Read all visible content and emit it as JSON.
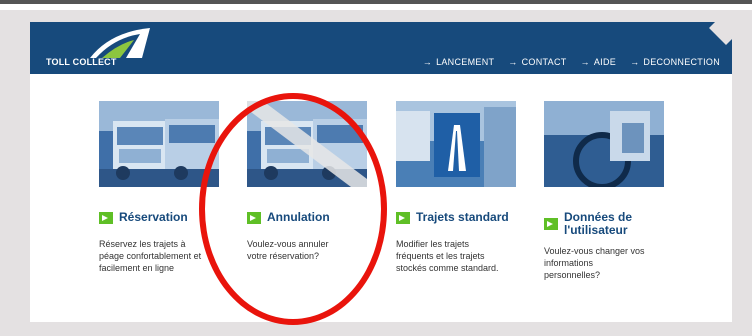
{
  "header": {
    "brand": "TOLL COLLECT",
    "brand_color": "#174a7c",
    "nav": [
      {
        "label": "LANCEMENT"
      },
      {
        "label": "CONTACT"
      },
      {
        "label": "AIDE"
      },
      {
        "label": "DECONNECTION"
      }
    ]
  },
  "cards": [
    {
      "title": "Réservation",
      "desc": [
        "Réservez les trajets à",
        "péage confortablement et",
        "facilement en ligne"
      ],
      "icon": "truck-photo"
    },
    {
      "title": "Annulation",
      "desc": [
        "Voulez-vous annuler",
        "votre réservation?"
      ],
      "icon": "truck-photo-crossed"
    },
    {
      "title": "Trajets standard",
      "desc": [
        "Modifier les trajets",
        "fréquents et les trajets",
        "stockés comme standard."
      ],
      "icon": "highway-photo"
    },
    {
      "title": [
        "Données de",
        "l'utilisateur"
      ],
      "desc": [
        "Voulez-vous changer vos",
        "informations",
        "personnelles?"
      ],
      "icon": "driver-photo"
    }
  ],
  "colors": {
    "accent_green": "#5fbf26",
    "highlight_red": "#e9140c"
  }
}
